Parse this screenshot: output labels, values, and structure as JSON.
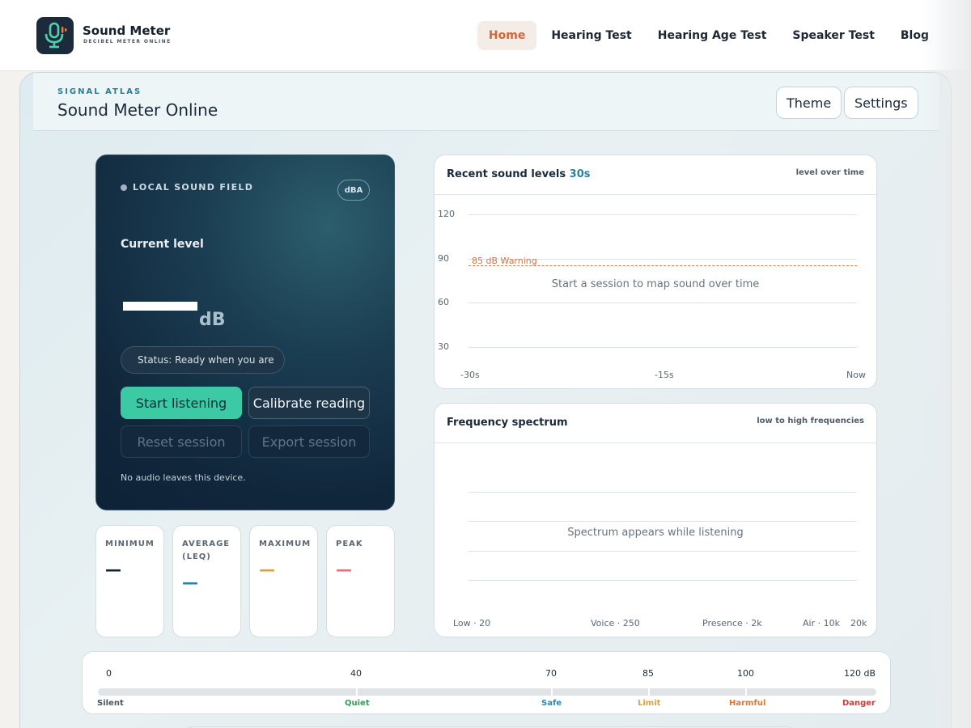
{
  "brand": {
    "name": "Sound Meter",
    "tagline": "DECIBEL METER ONLINE"
  },
  "nav": [
    {
      "label": "Home",
      "active": true
    },
    {
      "label": "Hearing Test",
      "active": false
    },
    {
      "label": "Hearing Age Test",
      "active": false
    },
    {
      "label": "Speaker Test",
      "active": false
    },
    {
      "label": "Blog",
      "active": false
    }
  ],
  "header": {
    "eyebrow": "SIGNAL ATLAS",
    "title": "Sound Meter Online",
    "theme_label": "Theme",
    "settings_label": "Settings"
  },
  "meter": {
    "eyebrow": "LOCAL SOUND FIELD",
    "weighting": "dBA",
    "current_label": "Current level",
    "unit": "dB",
    "status": "Status: Ready when you are",
    "start_label": "Start listening",
    "calibrate_label": "Calibrate reading",
    "reset_label": "Reset session",
    "export_label": "Export session",
    "privacy_note": "No audio leaves this device."
  },
  "stats": [
    {
      "label": "MINIMUM",
      "value": "—",
      "color": "#13202e"
    },
    {
      "label": "AVERAGE (LEQ)",
      "value": "—",
      "color": "#2b82a0"
    },
    {
      "label": "MAXIMUM",
      "value": "—",
      "color": "#d9a04a"
    },
    {
      "label": "PEAK",
      "value": "—",
      "color": "#e0707a"
    }
  ],
  "recent_panel": {
    "title": "Recent sound levels",
    "title_accent": "30s",
    "meta": "level over time",
    "y_ticks": [
      "120",
      "90",
      "60",
      "30"
    ],
    "x_ticks": [
      "-30s",
      "-15s",
      "Now"
    ],
    "warning_label": "85 dB Warning",
    "placeholder": "Start a session to map sound over time"
  },
  "spectrum_panel": {
    "title": "Frequency spectrum",
    "meta": "low to high frequencies",
    "x_ticks": [
      "Low · 20",
      "Voice · 250",
      "Presence · 2k",
      "Air · 10k",
      "20k"
    ],
    "placeholder": "Spectrum appears while listening"
  },
  "scale": {
    "numbers": [
      "0",
      "40",
      "70",
      "85",
      "100",
      "120 dB"
    ],
    "words": [
      {
        "label": "Silent",
        "color": "#4a5563"
      },
      {
        "label": "Quiet",
        "color": "#2fa05a"
      },
      {
        "label": "Safe",
        "color": "#2b8bb0"
      },
      {
        "label": "Limit",
        "color": "#e0a23a"
      },
      {
        "label": "Harmful",
        "color": "#d9772e"
      },
      {
        "label": "Danger",
        "color": "#d9333a"
      }
    ]
  },
  "colors": {
    "accent": "#d4673a",
    "primary_button": "#3ccaa4",
    "meter_bg": "#10263b",
    "warning": "#e07c4b"
  }
}
